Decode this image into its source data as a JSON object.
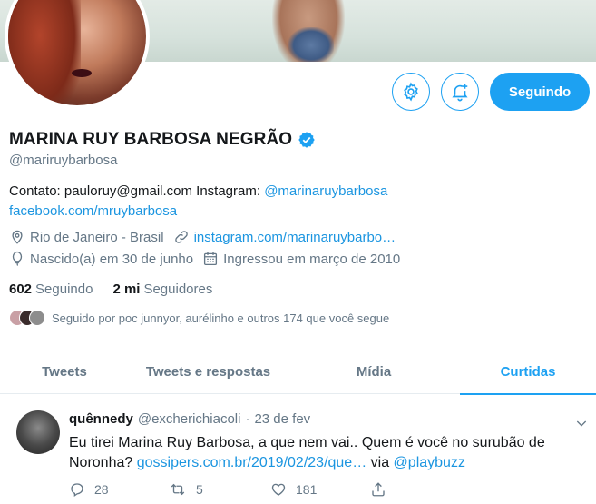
{
  "profile": {
    "name": "MARINA RUY BARBOSA NEGRÃO",
    "handle": "@mariruybarbosa",
    "follow_label": "Seguindo",
    "bio_prefix": "Contato: pauloruy@gmail.com Instagram: ",
    "bio_instagram": "@marinaruybarbosa",
    "bio_facebook": "facebook.com/mruybarbosa",
    "location": "Rio de Janeiro - Brasil",
    "website": "instagram.com/marinaruybarbo…",
    "birthday": "Nascido(a) em 30 de junho",
    "joined": "Ingressou em março de 2010",
    "following_count": "602",
    "following_label": "Seguindo",
    "followers_count": "2 mi",
    "followers_label": "Seguidores",
    "followed_by": "Seguido por poc junnyor, aurélinho e outros 174 que você segue"
  },
  "icons": {
    "settings": "gear-icon",
    "notify": "bell-plus-icon",
    "verified": "verified-badge-icon",
    "location": "location-pin-icon",
    "link": "link-icon",
    "birthday": "balloon-icon",
    "joined": "calendar-icon",
    "reply": "reply-icon",
    "retweet": "retweet-icon",
    "like": "heart-icon",
    "share": "share-icon",
    "caret": "chevron-down-icon"
  },
  "colors": {
    "accent": "#1da1f2",
    "link": "#1b95e0",
    "muted": "#657786",
    "text": "#14171a"
  },
  "tabs": [
    {
      "label": "Tweets",
      "active": false
    },
    {
      "label": "Tweets e respostas",
      "active": false
    },
    {
      "label": "Mídia",
      "active": false
    },
    {
      "label": "Curtidas",
      "active": true
    }
  ],
  "tweet": {
    "author_name": "quênnedy",
    "author_handle": "@excherichiacoli",
    "separator": "·",
    "date": "23 de fev",
    "text_part1": "Eu tirei Marina Ruy Barbosa, a que nem vai.. Quem é você no surubão de Noronha? ",
    "text_link": "gossipers.com.br/2019/02/23/que…",
    "text_via": " via ",
    "text_mention": "@playbuzz",
    "reply_count": "28",
    "retweet_count": "5",
    "like_count": "181"
  }
}
